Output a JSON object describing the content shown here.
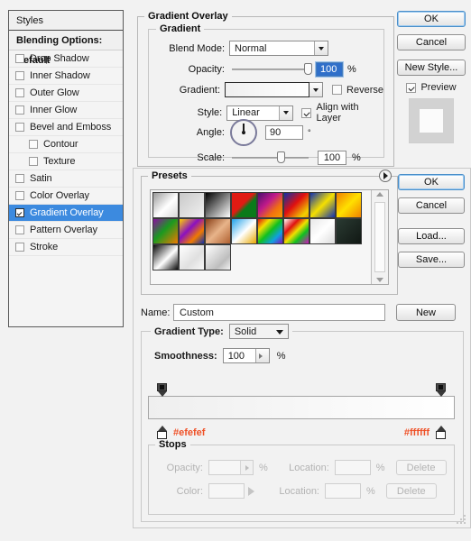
{
  "styles_panel": {
    "header": "Styles",
    "blending_options": "Blending Options: Default",
    "items": [
      {
        "label": "Drop Shadow",
        "checked": false,
        "indent": false,
        "selected": false
      },
      {
        "label": "Inner Shadow",
        "checked": false,
        "indent": false,
        "selected": false
      },
      {
        "label": "Outer Glow",
        "checked": false,
        "indent": false,
        "selected": false
      },
      {
        "label": "Inner Glow",
        "checked": false,
        "indent": false,
        "selected": false
      },
      {
        "label": "Bevel and Emboss",
        "checked": false,
        "indent": false,
        "selected": false
      },
      {
        "label": "Contour",
        "checked": false,
        "indent": true,
        "selected": false
      },
      {
        "label": "Texture",
        "checked": false,
        "indent": true,
        "selected": false
      },
      {
        "label": "Satin",
        "checked": false,
        "indent": false,
        "selected": false
      },
      {
        "label": "Color Overlay",
        "checked": false,
        "indent": false,
        "selected": false
      },
      {
        "label": "Gradient Overlay",
        "checked": true,
        "indent": false,
        "selected": true
      },
      {
        "label": "Pattern Overlay",
        "checked": false,
        "indent": false,
        "selected": false
      },
      {
        "label": "Stroke",
        "checked": false,
        "indent": false,
        "selected": false
      }
    ]
  },
  "gradient_overlay": {
    "title": "Gradient Overlay",
    "group_title": "Gradient",
    "blend_mode": {
      "label": "Blend Mode:",
      "value": "Normal"
    },
    "opacity": {
      "label": "Opacity:",
      "value": "100",
      "unit": "%",
      "percent": 100
    },
    "gradient": {
      "label": "Gradient:",
      "from": "#efefef",
      "to": "#ffffff"
    },
    "reverse": {
      "label": "Reverse",
      "checked": false
    },
    "style": {
      "label": "Style:",
      "value": "Linear"
    },
    "align_with_layer": {
      "label": "Align with Layer",
      "checked": true
    },
    "angle": {
      "label": "Angle:",
      "value": "90",
      "unit": "°",
      "degrees": 90
    },
    "scale": {
      "label": "Scale:",
      "value": "100",
      "unit": "%",
      "percent": 100
    }
  },
  "dialog_buttons": {
    "ok": "OK",
    "cancel": "Cancel",
    "new_style": "New Style...",
    "preview": {
      "label": "Preview",
      "checked": true
    }
  },
  "gradient_editor": {
    "presets": {
      "title": "Presets",
      "menu_icon": "preset-menu-arrow-icon",
      "swatches": [
        {
          "name": "foreground-to-background",
          "css": "linear-gradient(135deg,#9a9a9a 0%,#ffffff 55%,#d7d7d7 100%)"
        },
        {
          "name": "foreground-to-transparent",
          "css": "linear-gradient(135deg,#c9c9c9 0%,#f0f0f0 100%)"
        },
        {
          "name": "black-white",
          "css": "linear-gradient(135deg,#000000 0%,#ffffff 100%)"
        },
        {
          "name": "red-green",
          "css": "linear-gradient(135deg,#e01b13 0%,#e01b13 45%,#0a7a1a 60%,#0a7a1a 100%)"
        },
        {
          "name": "violet-orange",
          "css": "linear-gradient(135deg,#4a1070 0%,#c01a8a 40%,#f07010 70%,#f59a00 100%)"
        },
        {
          "name": "blue-red-yellow",
          "css": "linear-gradient(135deg,#0f2fa8 0%,#e01010 45%,#f0d000 85%,#f0a000 100%)"
        },
        {
          "name": "blue-yellow-blue",
          "css": "linear-gradient(135deg,#1030b0 0%,#f5e000 50%,#1030b0 100%)"
        },
        {
          "name": "orange-yellow-orange",
          "css": "linear-gradient(135deg,#f08000 0%,#ffe000 50%,#f08000 100%)"
        },
        {
          "name": "violet-green-orange",
          "css": "linear-gradient(135deg,#8a10a0 0%,#1a9a20 45%,#f07a00 100%)"
        },
        {
          "name": "yellow-violet-orange-blue",
          "css": "linear-gradient(135deg,#ffd000 0%,#8a10c0 40%,#f07a00 70%,#1030b0 100%)"
        },
        {
          "name": "copper",
          "css": "linear-gradient(135deg,#8a4018 0%,#e8b48a 50%,#b06030 100%)"
        },
        {
          "name": "chrome",
          "css": "linear-gradient(135deg,#1fa0e8 0%,#ffffff 52%,#e8a800 100%)"
        },
        {
          "name": "spectrum",
          "css": "linear-gradient(135deg,#e01010 0%,#f0e000 25%,#10c020 50%,#10a0e0 75%,#8010c0 100%)"
        },
        {
          "name": "transparent-rainbow",
          "css": "linear-gradient(135deg,#ffffff 0%,#e01010 30%,#f0e000 50%,#10c020 70%,#d010c0 100%)"
        },
        {
          "name": "transparent-stripes",
          "css": "linear-gradient(135deg,#e8e8e8 0%,#ffffff 50%,#dcdcdc 100%)"
        },
        {
          "name": "dark-green-black",
          "css": "linear-gradient(135deg,#2a3a32 0%,#111814 100%)"
        },
        {
          "name": "black-white-diagonal",
          "css": "linear-gradient(135deg,#0a0a0a 0%,#ffffff 55%,#0a0a0a 100%)"
        },
        {
          "name": "white-fade",
          "css": "linear-gradient(135deg,#ffffff 0%,#e0e0e0 60%,#f8f8f8 100%)"
        },
        {
          "name": "light-gray-fade",
          "css": "linear-gradient(135deg,#ffffff 0%,#bdbdbd 70%,#f2f2f2 100%)"
        }
      ]
    },
    "name": {
      "label": "Name:",
      "value": "Custom",
      "placeholder": "Custom"
    },
    "new_button": "New",
    "ok": "OK",
    "cancel": "Cancel",
    "load": "Load...",
    "save": "Save...",
    "gradient_type": {
      "label": "Gradient Type:",
      "value": "Solid"
    },
    "smoothness": {
      "label": "Smoothness:",
      "value": "100",
      "unit": "%"
    },
    "gradient_bar": {
      "from_hex": "#efefef",
      "to_hex": "#ffffff",
      "left_label": "#efefef",
      "right_label": "#ffffff"
    },
    "stops": {
      "title": "Stops",
      "opacity_label": "Opacity:",
      "opacity_value": "",
      "opacity_unit": "%",
      "location_label_1": "Location:",
      "location_value_1": "",
      "location_unit_1": "%",
      "delete_1": "Delete",
      "color_label": "Color:",
      "location_label_2": "Location:",
      "location_value_2": "",
      "location_unit_2": "%",
      "delete_2": "Delete"
    }
  },
  "colors": {
    "selection_blue": "#3c8adf",
    "hex_label_orange": "#ef5026",
    "dialog_bg": "#f2f2f2",
    "field_selected": "#2f6fc9"
  }
}
